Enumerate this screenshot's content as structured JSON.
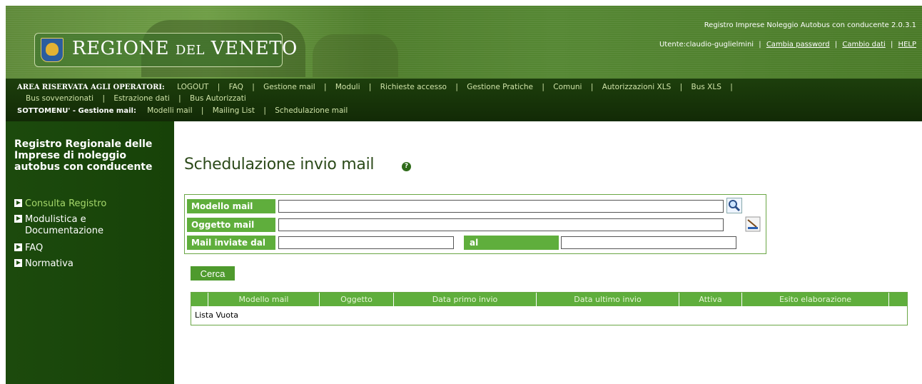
{
  "header": {
    "logo_text_main1": "REGIONE ",
    "logo_text_small": "DEL",
    "logo_text_main2": " VENETO",
    "app_title": "Registro Imprese Noleggio Autobus con conducente 2.0.3.1",
    "user_label": "Utente:claudio-guglielmini",
    "link_change_password": "Cambia password",
    "link_change_data": "Cambio dati",
    "link_help": "HELP",
    "sep": "|"
  },
  "menu": {
    "lead": "AREA RISERVATA AGLI OPERATORI:",
    "items_row1": [
      "LOGOUT",
      "FAQ",
      "Gestione mail",
      "Moduli",
      "Richieste accesso",
      "Gestione Pratiche",
      "Comuni",
      "Autorizzazioni XLS",
      "Bus XLS"
    ],
    "items_row2": [
      "Bus sovvenzionati",
      "Estrazione dati",
      "Bus Autorizzati"
    ],
    "submenu_lead": "SOTTOMENU' - Gestione mail:",
    "submenu_items": [
      "Modelli mail",
      "Mailing List",
      "Schedulazione mail"
    ],
    "pipe": "|"
  },
  "sidebar": {
    "title": "Registro Regionale delle Imprese di noleggio autobus con conducente",
    "items": [
      {
        "label": "Consulta Registro"
      },
      {
        "label_line1": "Modulistica e",
        "label_line2": "Documentazione"
      },
      {
        "label": "FAQ"
      },
      {
        "label": "Normativa"
      }
    ]
  },
  "main": {
    "title": "Schedulazione invio mail",
    "help_icon": "question-icon",
    "filters": {
      "modello_label": "Modello mail",
      "modello_value": "",
      "oggetto_label": "Oggetto mail",
      "oggetto_value": "",
      "inviate_dal_label": "Mail inviate dal",
      "inviate_dal_value": "",
      "al_label": "al",
      "al_value": ""
    },
    "search_button": "Cerca",
    "table": {
      "columns": [
        "Modello mail",
        "Oggetto",
        "Data primo invio",
        "Data ultimo invio",
        "Attiva",
        "Esito elaborazione"
      ],
      "empty_text": "Lista Vuota"
    }
  },
  "colors": {
    "header_green": "#5f8a3a",
    "menu_dark": "#122a06",
    "sidebar_green": "#1c4a0d",
    "label_green": "#5fae3c",
    "accent_link": "#a6d86b"
  }
}
